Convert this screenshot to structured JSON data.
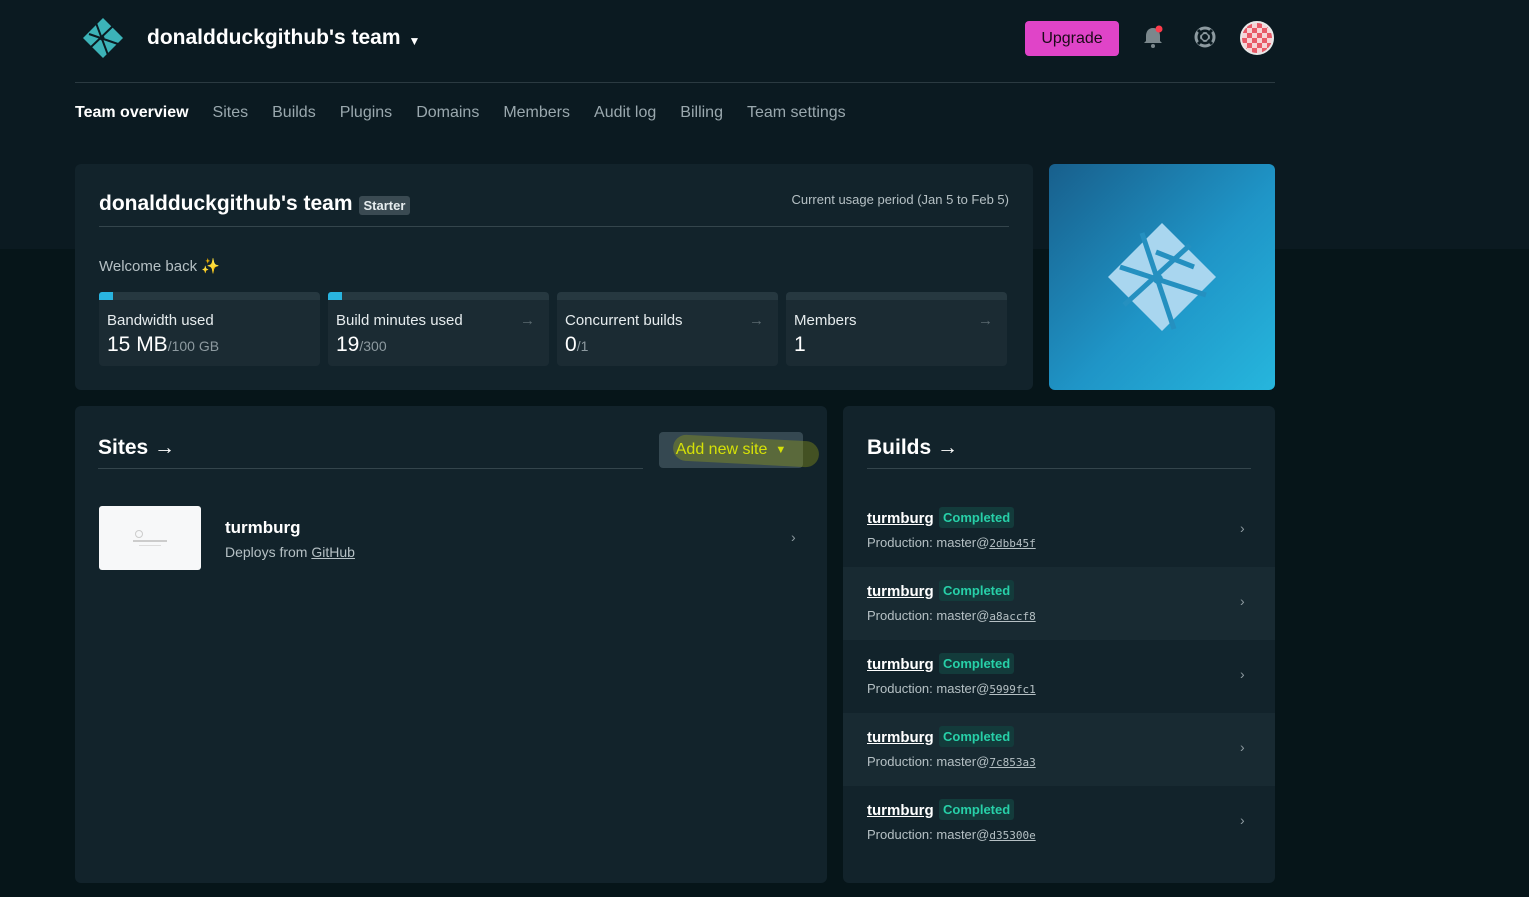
{
  "header": {
    "team_name": "donaldduckgithub's team",
    "upgrade_label": "Upgrade"
  },
  "tabs": [
    {
      "label": "Team overview",
      "active": true
    },
    {
      "label": "Sites"
    },
    {
      "label": "Builds"
    },
    {
      "label": "Plugins"
    },
    {
      "label": "Domains"
    },
    {
      "label": "Members"
    },
    {
      "label": "Audit log"
    },
    {
      "label": "Billing"
    },
    {
      "label": "Team settings"
    }
  ],
  "overview": {
    "title": "donaldduckgithub's team",
    "plan_badge": "Starter",
    "usage_period": "Current usage period (Jan 5 to Feb 5)",
    "welcome": "Welcome back ✨",
    "stats": [
      {
        "label": "Bandwidth used",
        "value": "15 MB",
        "of": "/100 GB",
        "fraction": 0.0001
      },
      {
        "label": "Build minutes used",
        "value": "19",
        "of": "/300",
        "fraction": 0.063
      },
      {
        "label": "Concurrent builds",
        "value": "0",
        "of": "/1",
        "fraction": 0
      },
      {
        "label": "Members",
        "value": "1",
        "of": ""
      }
    ]
  },
  "sites": {
    "title": "Sites →",
    "add_button": "Add new site",
    "items": [
      {
        "name": "turmburg",
        "deploys_prefix": "Deploys from",
        "provider": "GitHub"
      }
    ]
  },
  "builds": {
    "title": "Builds →",
    "items": [
      {
        "site": "turmburg",
        "status": "Completed",
        "context": "Production:",
        "branch": "master@",
        "sha": "2dbb45f"
      },
      {
        "site": "turmburg",
        "status": "Completed",
        "context": "Production:",
        "branch": "master@",
        "sha": "a8accf8"
      },
      {
        "site": "turmburg",
        "status": "Completed",
        "context": "Production:",
        "branch": "master@",
        "sha": "5999fc1"
      },
      {
        "site": "turmburg",
        "status": "Completed",
        "context": "Production:",
        "branch": "master@",
        "sha": "7c853a3"
      },
      {
        "site": "turmburg",
        "status": "Completed",
        "context": "Production:",
        "branch": "master@",
        "sha": "d35300e"
      }
    ]
  },
  "colors": {
    "accent_upgrade": "#e044c8",
    "status_completed": "#27d0a8",
    "progress": "#29b4e0",
    "highlight": "#f2ff00"
  },
  "icons": [
    "netlify-logo-icon",
    "chevron-down-icon",
    "bell-icon",
    "help-icon",
    "avatar",
    "arrow-right-icon",
    "chevron-right-icon"
  ]
}
